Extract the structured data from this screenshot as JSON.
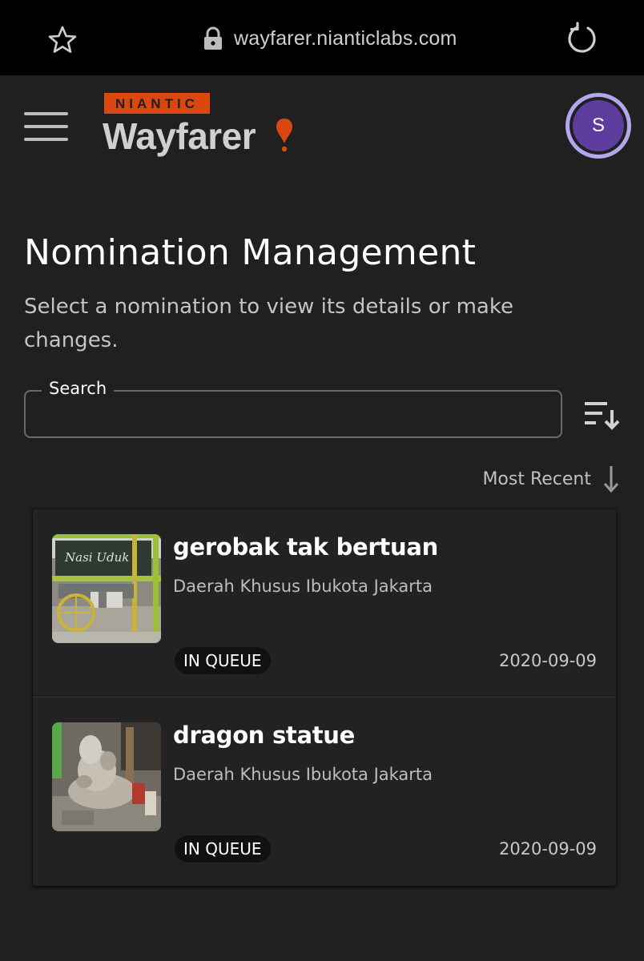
{
  "browser": {
    "url": "wayfarer.nianticlabs.com",
    "icons": [
      "star-icon",
      "lock-icon",
      "reload-icon"
    ]
  },
  "header": {
    "brand_badge": "NIANTIC",
    "brand_name": "Wayfarer",
    "avatar_initial": "S",
    "colors": {
      "brand_orange": "#d9480f",
      "avatar_ring": "#b3a7ec",
      "avatar_fill": "#5e3c9e"
    }
  },
  "page": {
    "title": "Nomination Management",
    "subtitle": "Select a nomination to view its details or make changes."
  },
  "search": {
    "label": "Search",
    "value": "",
    "placeholder": ""
  },
  "sort": {
    "label": "Most Recent",
    "direction_icon": "arrow-down-icon"
  },
  "nominations": [
    {
      "title": "gerobak tak bertuan",
      "location": "Daerah Khusus Ibukota Jakarta",
      "status": "IN QUEUE",
      "date": "2020-09-09"
    },
    {
      "title": "dragon statue",
      "location": "Daerah Khusus Ibukota Jakarta",
      "status": "IN QUEUE",
      "date": "2020-09-09"
    }
  ]
}
